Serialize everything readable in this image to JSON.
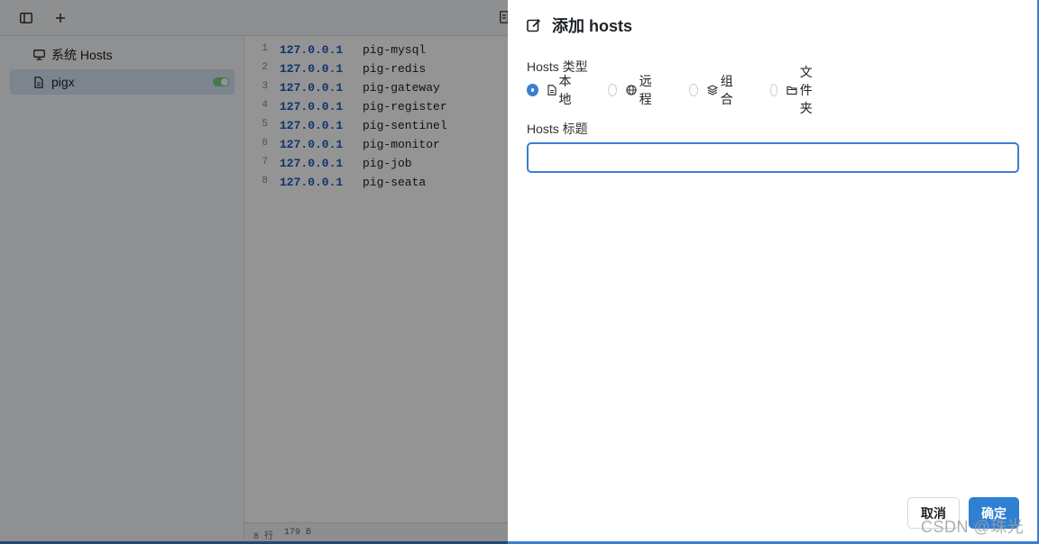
{
  "app": {
    "sidebar": {
      "items": [
        {
          "label": "系统 Hosts",
          "icon": "monitor-icon"
        },
        {
          "label": "pigx",
          "icon": "file-icon",
          "enabled": true
        }
      ]
    },
    "editor": {
      "lines": [
        {
          "num": "1",
          "ip": "127.0.0.1",
          "host": "pig-mysql"
        },
        {
          "num": "2",
          "ip": "127.0.0.1",
          "host": "pig-redis"
        },
        {
          "num": "3",
          "ip": "127.0.0.1",
          "host": "pig-gateway"
        },
        {
          "num": "4",
          "ip": "127.0.0.1",
          "host": "pig-register"
        },
        {
          "num": "5",
          "ip": "127.0.0.1",
          "host": "pig-sentinel"
        },
        {
          "num": "6",
          "ip": "127.0.0.1",
          "host": "pig-monitor"
        },
        {
          "num": "7",
          "ip": "127.0.0.1",
          "host": "pig-job"
        },
        {
          "num": "8",
          "ip": "127.0.0.1",
          "host": "pig-seata"
        }
      ],
      "status_lines": "8 行",
      "status_size": "179 B"
    }
  },
  "dialog": {
    "title": "添加 hosts",
    "type_label": "Hosts 类型",
    "types": [
      {
        "label": "本地",
        "icon": "file-icon",
        "checked": true
      },
      {
        "label": "远程",
        "icon": "globe-icon",
        "checked": false
      },
      {
        "label": "组合",
        "icon": "layers-icon",
        "checked": false
      },
      {
        "label": "文件夹",
        "icon": "folder-icon",
        "checked": false
      }
    ],
    "title_label": "Hosts 标题",
    "title_value": "",
    "cancel_label": "取消",
    "ok_label": "确定"
  },
  "watermark": "CSDN @珠光",
  "colors": {
    "accent": "#2f7fd3",
    "ip": "#1e5bbf",
    "toggle_on": "#7bd07a"
  }
}
